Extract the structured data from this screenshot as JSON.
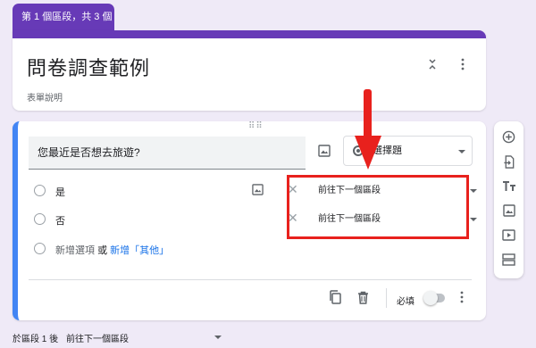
{
  "section_tab": "第 1 個區段，共 3 個",
  "header": {
    "title": "問卷調查範例",
    "description": "表單說明",
    "collapse_icon": "collapse-icon",
    "more_icon": "more-vert-icon"
  },
  "question": {
    "title": "您最近是否想去旅遊?",
    "type": "選擇題",
    "options": [
      {
        "label": "是",
        "goto": "前往下一個區段"
      },
      {
        "label": "否",
        "goto": "前往下一個區段"
      }
    ],
    "add_option": "新增選項",
    "or": "或",
    "add_other": "新增「其他」",
    "required_label": "必填",
    "required": false
  },
  "bottom": {
    "after_section": "於區段 1 後",
    "after_section_goto": "前往下一個區段"
  },
  "side_toolbar": [
    "add-question-icon",
    "import-question-icon",
    "add-title-icon",
    "add-image-icon",
    "add-video-icon",
    "add-section-icon"
  ],
  "colors": {
    "accent": "#673ab7",
    "background": "#efeaf7",
    "active_border": "#4285f4",
    "annotation_red": "#e8211d",
    "link_blue": "#1a73e8"
  }
}
